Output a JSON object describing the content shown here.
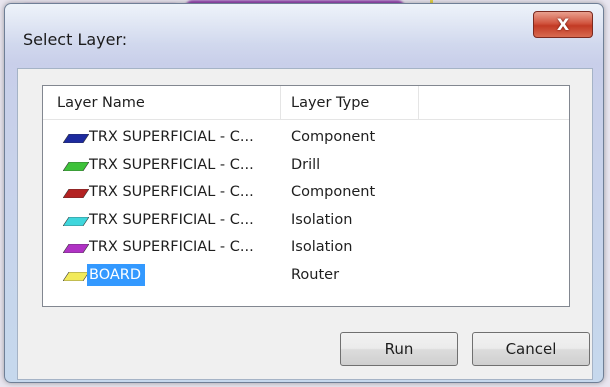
{
  "dialog": {
    "title": "Select Layer:",
    "close_glyph": "X",
    "columns": [
      "Layer Name",
      "Layer Type"
    ],
    "rows": [
      {
        "name": "TRX SUPERFICIAL - C...",
        "type": "Component",
        "color": "#1d2a9e",
        "selected": false
      },
      {
        "name": "TRX SUPERFICIAL - C...",
        "type": "Drill",
        "color": "#3ec23a",
        "selected": false
      },
      {
        "name": "TRX SUPERFICIAL - C...",
        "type": "Component",
        "color": "#b32222",
        "selected": false
      },
      {
        "name": "TRX SUPERFICIAL - C...",
        "type": "Isolation",
        "color": "#3fd6dc",
        "selected": false
      },
      {
        "name": "TRX SUPERFICIAL - C...",
        "type": "Isolation",
        "color": "#b032c4",
        "selected": false
      },
      {
        "name": "BOARD",
        "type": "Router",
        "color": "#f2ea5a",
        "selected": true
      }
    ],
    "buttons": {
      "run": "Run",
      "cancel": "Cancel"
    }
  },
  "colors": {
    "selection": "#3399ff",
    "close_button": "#c23a24",
    "background_accent": "#8a2fa8"
  }
}
